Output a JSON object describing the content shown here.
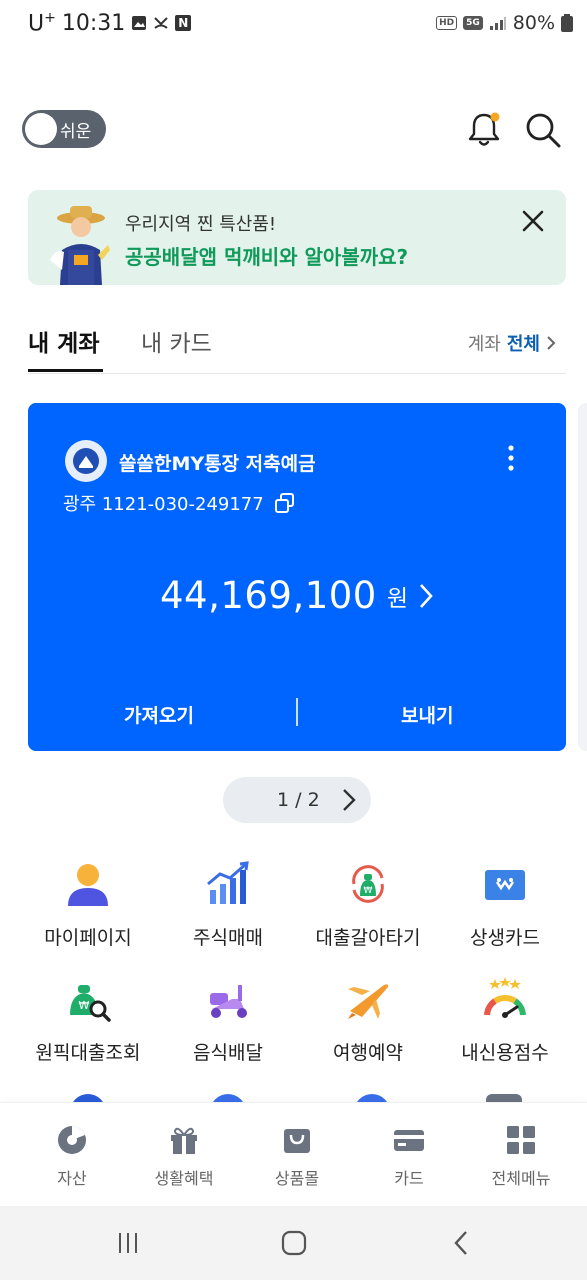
{
  "status_bar": {
    "carrier": "U",
    "carrier_sup": "+",
    "time": "10:31",
    "network": "5G",
    "hd_badge": "HD",
    "n_badge": "N",
    "battery": "80%"
  },
  "header": {
    "toggle_label": "쉬운",
    "toggle_on": false
  },
  "banner": {
    "line1": "우리지역 찐 특산품!",
    "line2": "공공배달앱 먹깨비와 알아볼까요?"
  },
  "tabs": {
    "items": [
      "내 계좌",
      "내 카드"
    ],
    "active_index": 0,
    "all_prefix": "계좌",
    "all_label": "전체"
  },
  "account_card": {
    "name": "쏠쏠한MY통장 저축예금",
    "number": "광주 1121-030-249177",
    "balance": "44,169,100",
    "balance_unit": "원",
    "action_left": "가져오기",
    "action_right": "보내기",
    "color": "#0064ff"
  },
  "pager": {
    "text": "1 / 2"
  },
  "menu_grid": [
    {
      "label": "마이페이지",
      "icon": "person-icon"
    },
    {
      "label": "주식매매",
      "icon": "stock-chart-icon"
    },
    {
      "label": "대출갈아타기",
      "icon": "loan-switch-icon"
    },
    {
      "label": "상생카드",
      "icon": "coop-card-icon"
    },
    {
      "label": "원픽대출조회",
      "icon": "loan-search-icon"
    },
    {
      "label": "음식배달",
      "icon": "delivery-scooter-icon"
    },
    {
      "label": "여행예약",
      "icon": "airplane-icon"
    },
    {
      "label": "내신용점수",
      "icon": "credit-gauge-icon"
    }
  ],
  "bottom_nav": [
    {
      "label": "자산",
      "icon": "pie-chart-icon"
    },
    {
      "label": "생활혜택",
      "icon": "gift-icon"
    },
    {
      "label": "상품몰",
      "icon": "shopping-bag-icon"
    },
    {
      "label": "카드",
      "icon": "card-icon"
    },
    {
      "label": "전체메뉴",
      "icon": "grid-menu-icon"
    }
  ],
  "colors": {
    "accent_blue": "#0064ff",
    "banner_bg": "#e3f3ec",
    "banner_green": "#0f9a5a",
    "link_blue": "#0a5fb0"
  }
}
